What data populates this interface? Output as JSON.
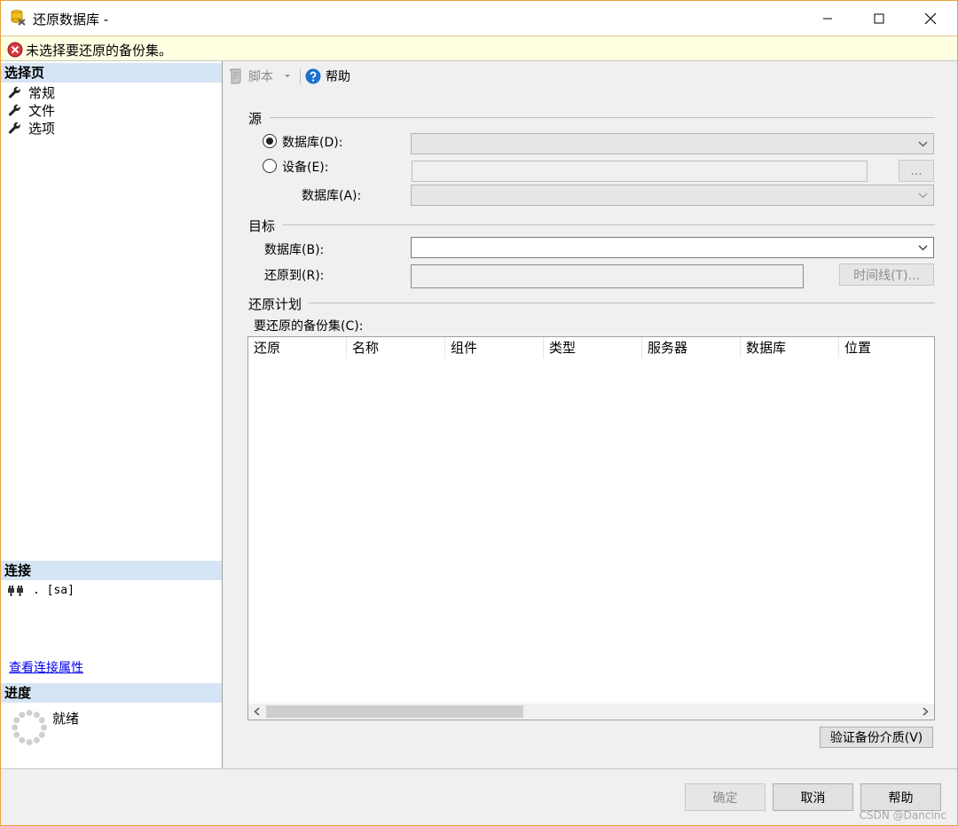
{
  "window": {
    "title": "还原数据库 -",
    "message": "未选择要还原的备份集。"
  },
  "left_pane": {
    "pages_header": "选择页",
    "pages": [
      {
        "label": "常规"
      },
      {
        "label": "文件"
      },
      {
        "label": "选项"
      }
    ],
    "connection_header": "连接",
    "connection_info": ". [sa]",
    "connection_link": "查看连接属性",
    "progress_header": "进度",
    "progress_status": "就绪"
  },
  "toolbar": {
    "script_label": "脚本",
    "help_label": "帮助"
  },
  "source": {
    "group_label": "源",
    "database_radio_label": "数据库(D):",
    "database_selected": true,
    "device_radio_label": "设备(E):",
    "browse_label": "...",
    "device_database_label": "数据库(A):"
  },
  "target": {
    "group_label": "目标",
    "database_label": "数据库(B):",
    "restore_to_label": "还原到(R):",
    "timeline_button": "时间线(T)..."
  },
  "plan": {
    "group_label": "还原计划",
    "backup_sets_label": "要还原的备份集(C):",
    "columns": [
      "还原",
      "名称",
      "组件",
      "类型",
      "服务器",
      "数据库",
      "位置"
    ],
    "verify_button": "验证备份介质(V)"
  },
  "footer": {
    "ok_button": "确定",
    "cancel_button": "取消",
    "help_button": "帮助",
    "watermark": "CSDN @Dancinc"
  }
}
